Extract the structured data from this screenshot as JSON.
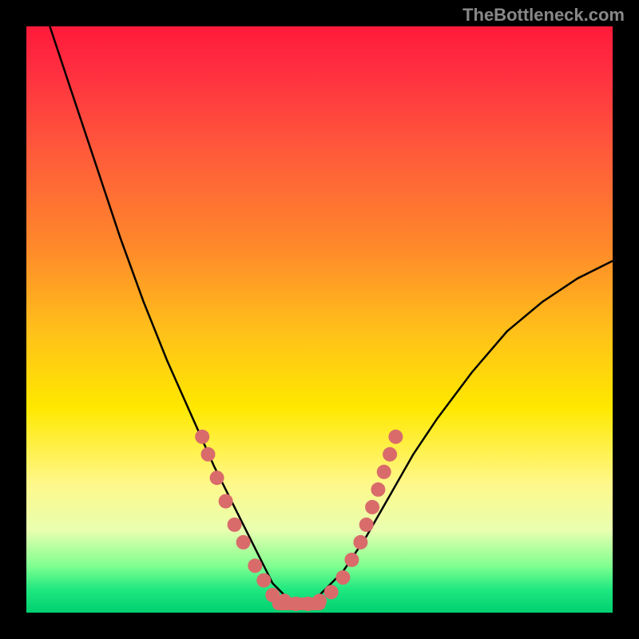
{
  "watermark": "TheBottleneck.com",
  "chart_data": {
    "type": "line",
    "title": "",
    "xlabel": "",
    "ylabel": "",
    "xlim": [
      0,
      100
    ],
    "ylim": [
      0,
      100
    ],
    "grid": false,
    "legend": false,
    "series": [
      {
        "name": "bottleneck-curve",
        "x": [
          4,
          8,
          12,
          16,
          20,
          24,
          28,
          32,
          34,
          36,
          38,
          40,
          42,
          44,
          46,
          48,
          50,
          54,
          58,
          62,
          66,
          70,
          76,
          82,
          88,
          94,
          100
        ],
        "y": [
          100,
          88,
          76,
          64,
          53,
          43,
          34,
          25,
          21,
          17,
          13,
          9,
          5,
          3,
          1.5,
          1.5,
          3,
          7,
          13,
          20,
          27,
          33,
          41,
          48,
          53,
          57,
          60
        ]
      }
    ],
    "markers": {
      "name": "highlight-points",
      "color": "#d96b6b",
      "points": [
        {
          "x": 30,
          "y": 30
        },
        {
          "x": 31,
          "y": 27
        },
        {
          "x": 32.5,
          "y": 23
        },
        {
          "x": 34,
          "y": 19
        },
        {
          "x": 35.5,
          "y": 15
        },
        {
          "x": 37,
          "y": 12
        },
        {
          "x": 39,
          "y": 8
        },
        {
          "x": 40.5,
          "y": 5.5
        },
        {
          "x": 42,
          "y": 3
        },
        {
          "x": 44,
          "y": 2
        },
        {
          "x": 46,
          "y": 1.5
        },
        {
          "x": 48,
          "y": 1.5
        },
        {
          "x": 50,
          "y": 2
        },
        {
          "x": 52,
          "y": 3.5
        },
        {
          "x": 54,
          "y": 6
        },
        {
          "x": 55.5,
          "y": 9
        },
        {
          "x": 57,
          "y": 12
        },
        {
          "x": 58,
          "y": 15
        },
        {
          "x": 59,
          "y": 18
        },
        {
          "x": 60,
          "y": 21
        },
        {
          "x": 61,
          "y": 24
        },
        {
          "x": 62,
          "y": 27
        },
        {
          "x": 63,
          "y": 30
        }
      ]
    }
  }
}
